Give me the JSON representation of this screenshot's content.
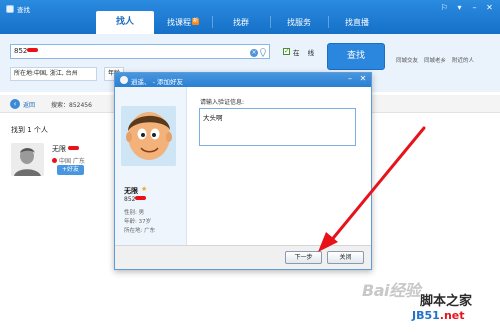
{
  "window": {
    "title": "查找",
    "controls": [
      "⚐",
      "▾",
      "–",
      "✕"
    ]
  },
  "tabs": [
    {
      "label": "找人",
      "active": true
    },
    {
      "label": "找课程",
      "badge": "新"
    },
    {
      "label": "找群"
    },
    {
      "label": "找服务"
    },
    {
      "label": "找直播"
    }
  ],
  "search": {
    "value": "852",
    "online_label": "在 线",
    "online_checked": true,
    "button": "查找",
    "quick_links": [
      "同城交友",
      "同城老乡",
      "附近的人"
    ],
    "filter_location": "所在地:中国, 浙江, 台州",
    "filter_age": "年龄"
  },
  "results": {
    "back": "返回",
    "summary": "搜索：852456",
    "count_text": "找到 1 个人",
    "item": {
      "name": "无限",
      "location": "中国 广东",
      "add_button": "+好友"
    }
  },
  "dialog": {
    "title": "逍遥、 - 添加好友",
    "name": "无限",
    "id": "852",
    "info": [
      "性别: 男",
      "年龄: 37岁",
      "所在地: 广东"
    ],
    "prompt": "请输入验证信息:",
    "message": "大头啊",
    "next_button": "下一步",
    "close_button": "关闭"
  },
  "watermark": {
    "baidu": "Bai经验",
    "jiaoben": "脚本之家",
    "site": "JB51",
    "site_suffix": ".net"
  },
  "colors": {
    "brand_blue": "#1670c8",
    "annotation_red": "#e8121b"
  }
}
